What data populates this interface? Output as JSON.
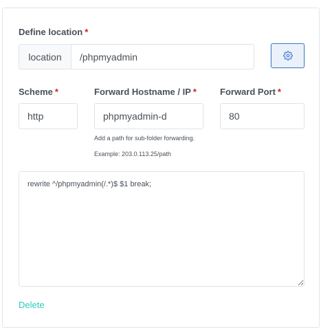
{
  "location": {
    "label": "Define location",
    "required_mark": "*",
    "addon": "location",
    "value": "/phpmyadmin",
    "settings_icon": "gear-icon"
  },
  "scheme": {
    "label": "Scheme",
    "required_mark": "*",
    "value": "http"
  },
  "forward_host": {
    "label": "Forward Hostname / IP",
    "required_mark": "*",
    "value": "phpmyadmin-d",
    "hint_1": "Add a path for sub-folder forwarding.",
    "hint_2": "Example: 203.0.113.25/path"
  },
  "forward_port": {
    "label": "Forward Port",
    "required_mark": "*",
    "value": "80"
  },
  "advanced_config": {
    "value": "rewrite ^/phpmyadmin(/.*)$ $1 break;"
  },
  "actions": {
    "delete_label": "Delete"
  },
  "colors": {
    "accent": "#467fcf",
    "required": "#cd201f",
    "delete_link": "#2bcbba"
  }
}
